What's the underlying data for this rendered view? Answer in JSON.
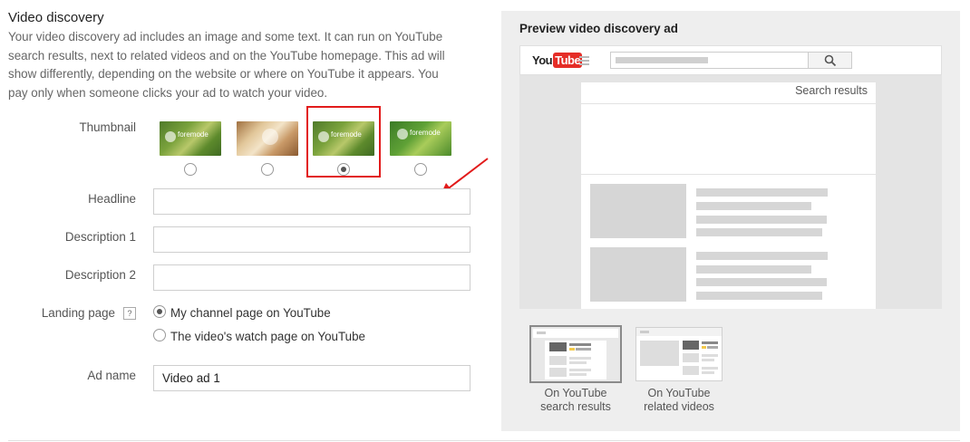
{
  "section": {
    "title": "Video discovery",
    "description": "Your video discovery ad includes an image and some text. It can run on YouTube search results, next to related videos and on the YouTube homepage. This ad will show differently, depending on the website or where on YouTube it appears. You pay only when someone clicks your ad to watch your video."
  },
  "form": {
    "thumbnail_label": "Thumbnail",
    "thumbnail_selected": 3,
    "headline_label": "Headline",
    "headline_value": "",
    "description1_label": "Description 1",
    "description1_value": "",
    "description2_label": "Description 2",
    "description2_value": "",
    "landing_label": "Landing page",
    "landing_help": "?",
    "landing_options": [
      "My channel page on YouTube",
      "The video's watch page on YouTube"
    ],
    "landing_selected": 0,
    "adname_label": "Ad name",
    "adname_value": "Video ad 1"
  },
  "thumb_marks": [
    "foremode",
    "",
    "foremode",
    "foremode"
  ],
  "preview": {
    "title": "Preview video discovery ad",
    "logo_you": "You",
    "logo_tube": "Tube",
    "search_results": "Search results",
    "options": [
      {
        "line1": "On YouTube",
        "line2": "search results"
      },
      {
        "line1": "On YouTube",
        "line2": "related videos"
      }
    ],
    "selected_option": 0
  },
  "colors": {
    "highlight": "#e21b1b",
    "arrow": "#e21b1b",
    "youtube_red": "#e52d27",
    "preview_bg": "#eeeeee",
    "placeholder": "#d6d6d6",
    "ad_yellow": "#f2c94c"
  },
  "icons": {
    "search": "magnifier-icon",
    "menu": "hamburger-icon",
    "help": "help-icon",
    "arrow": "annotation-arrow"
  }
}
